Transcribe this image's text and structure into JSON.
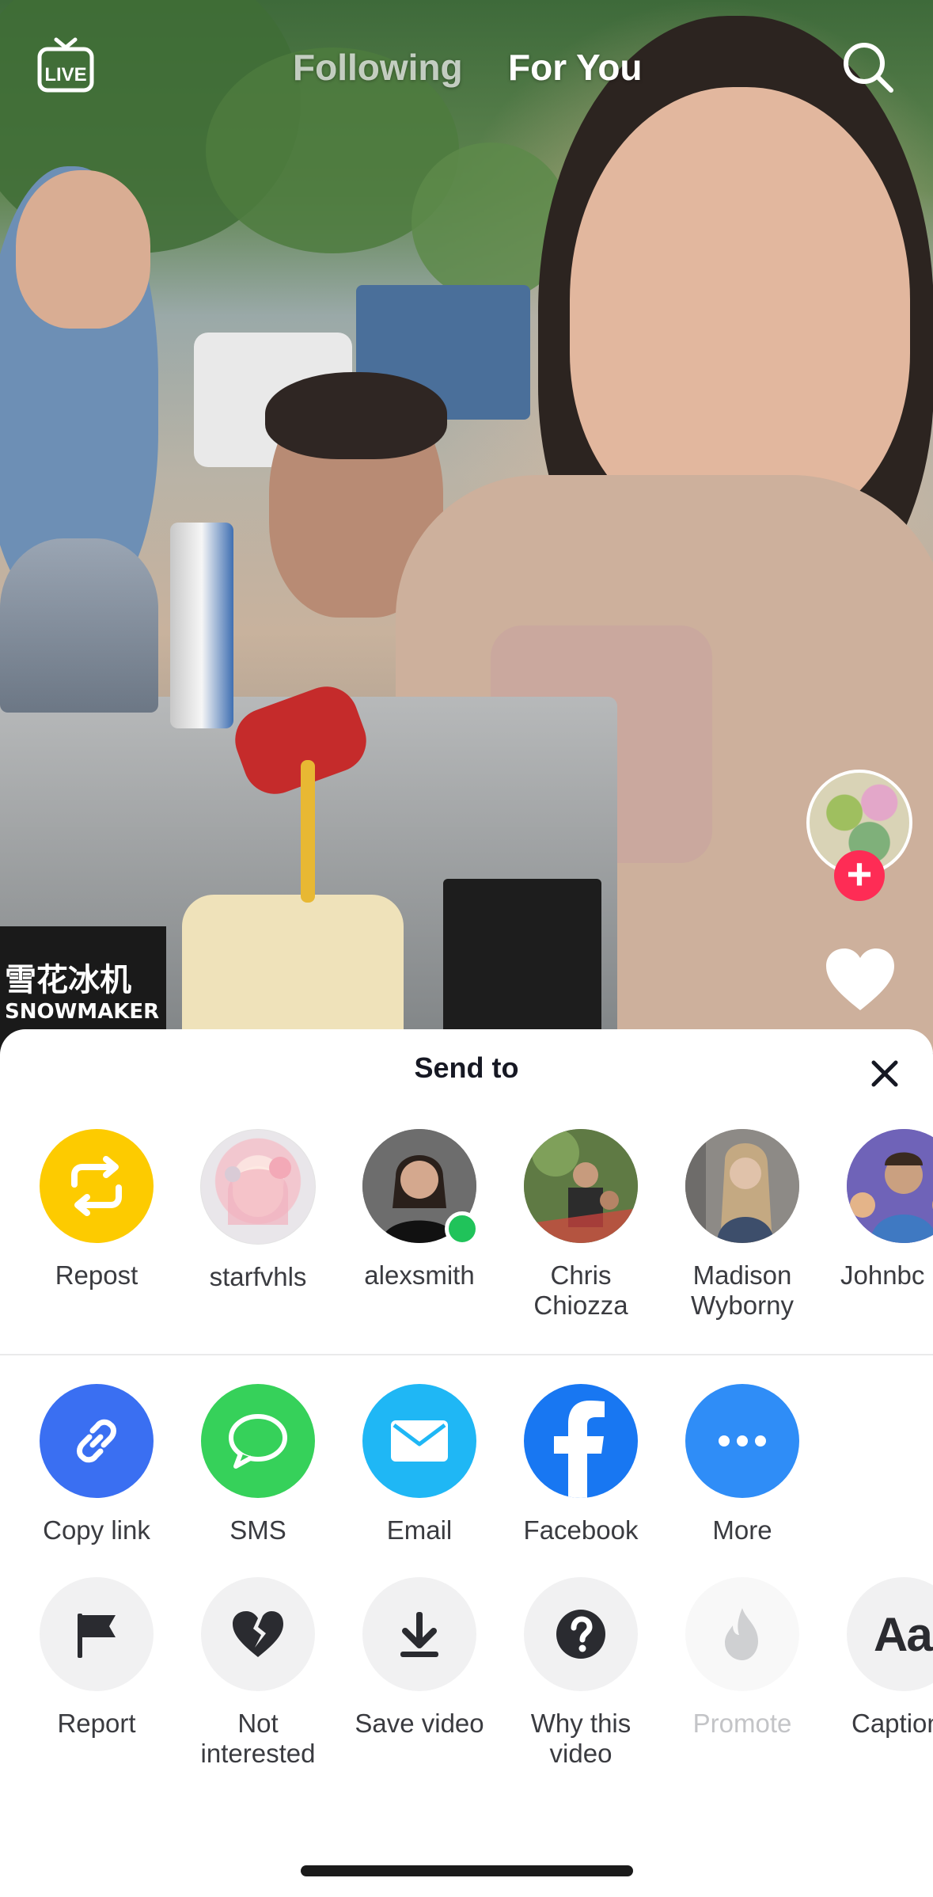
{
  "topbar": {
    "live_label": "LIVE",
    "tab_following": "Following",
    "tab_for_you": "For You",
    "active_tab": "For You"
  },
  "video": {
    "sign_text_cn": "雪花冰机",
    "sign_text_en": "SNOWMAKER"
  },
  "sheet": {
    "title": "Send to",
    "contacts": [
      {
        "label": "Repost",
        "icon": "repost-icon",
        "color": "#fdcb00"
      },
      {
        "label": "starfvhls",
        "avatar_color": "#f3d7dc"
      },
      {
        "label": "alexsmith",
        "avatar_color": "#2b2b2b",
        "online": true
      },
      {
        "label": "Chris\nChiozza",
        "avatar_color": "#6e7b52"
      },
      {
        "label": "Madison\nWyborny",
        "avatar_color": "#8a7f73"
      },
      {
        "label": "Johnbc",
        "avatar_color": "#7a6ab8"
      }
    ],
    "apps": [
      {
        "label": "Copy link",
        "icon": "link-icon",
        "color": "#3a6ff2"
      },
      {
        "label": "SMS",
        "icon": "sms-icon",
        "color": "#36d15a"
      },
      {
        "label": "Email",
        "icon": "email-icon",
        "color": "#1fb7f5"
      },
      {
        "label": "Facebook",
        "icon": "facebook-icon",
        "color": "#1877f2"
      },
      {
        "label": "More",
        "icon": "more-icon",
        "color": "#2f8df7"
      }
    ],
    "actions": [
      {
        "label": "Report",
        "icon": "flag-icon",
        "enabled": true
      },
      {
        "label": "Not\ninterested",
        "icon": "broken-heart-icon",
        "enabled": true
      },
      {
        "label": "Save video",
        "icon": "download-icon",
        "enabled": true
      },
      {
        "label": "Why this\nvideo",
        "icon": "question-icon",
        "enabled": true
      },
      {
        "label": "Promote",
        "icon": "flame-icon",
        "enabled": false
      },
      {
        "label": "Caption",
        "icon": "caption-icon",
        "enabled": true,
        "icon_text": "Aa"
      }
    ]
  },
  "colors": {
    "follow_plus": "#fe2c55",
    "sheet_bg": "#ffffff",
    "label": "#3a3b40",
    "disabled_label": "#c3c4c7"
  }
}
